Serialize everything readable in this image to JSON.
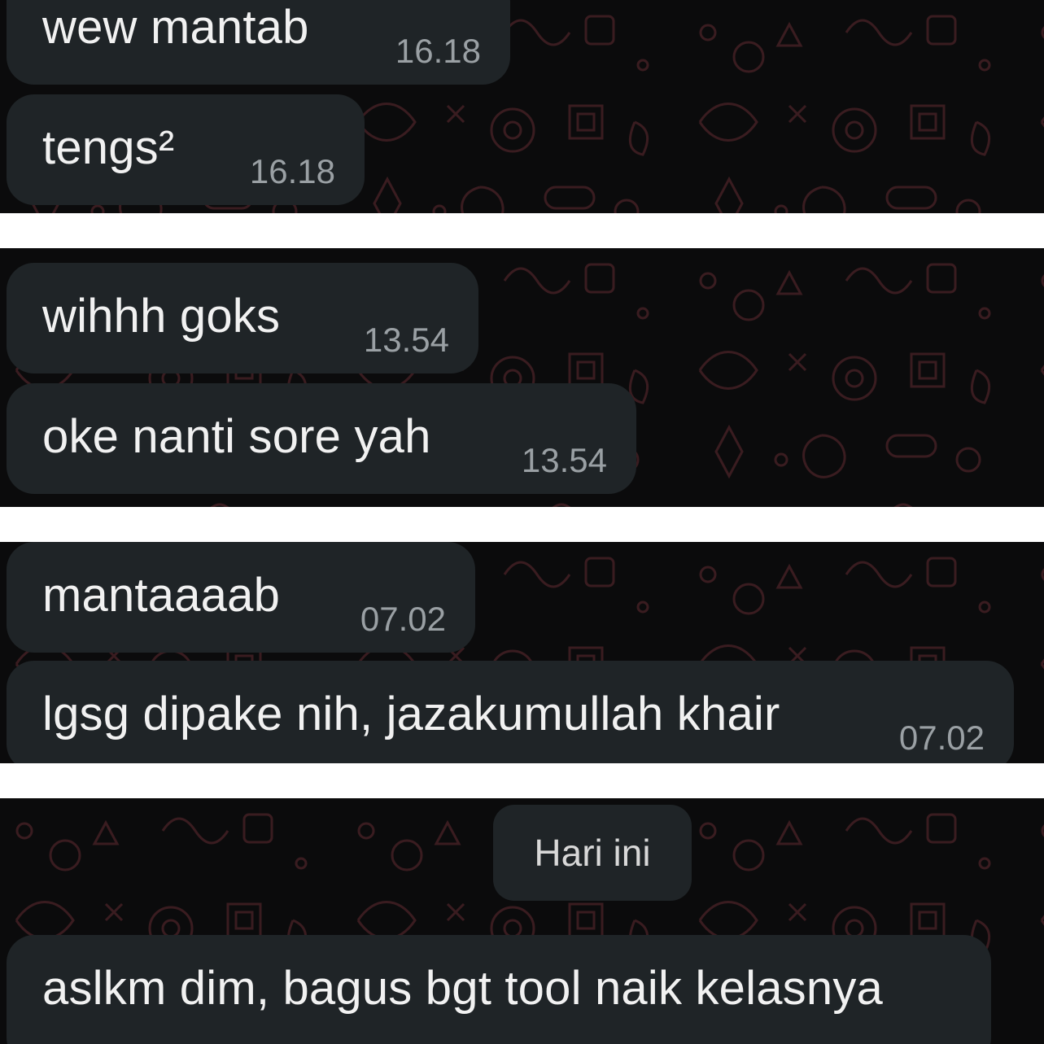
{
  "colors": {
    "background": "#0b0b0c",
    "bubble": "#1f2427",
    "message_text": "#f1f1f1",
    "timestamp_text": "#9aa0a4",
    "doodle": "#3a1c20",
    "separator": "#ffffff"
  },
  "panels": [
    {
      "messages": [
        {
          "text": "wew mantab",
          "time": "16.18"
        },
        {
          "text": "tengs²",
          "time": "16.18"
        }
      ]
    },
    {
      "messages": [
        {
          "text": "wihhh goks",
          "time": "13.54"
        },
        {
          "text": "oke nanti sore yah",
          "time": "13.54"
        }
      ]
    },
    {
      "messages": [
        {
          "text": "mantaaaab",
          "time": "07.02"
        },
        {
          "text": "lgsg dipake nih, jazakumullah khair",
          "time": "07.02"
        }
      ]
    },
    {
      "date_chip": "Hari ini",
      "messages": [
        {
          "text": "aslkm dim, bagus bgt tool naik kelasnya"
        }
      ]
    }
  ]
}
